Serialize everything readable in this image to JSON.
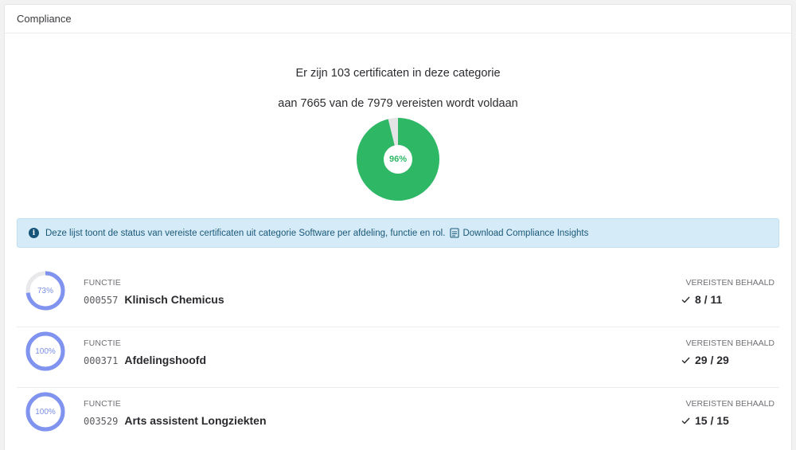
{
  "header": {
    "title": "Compliance"
  },
  "summary": {
    "certificates_line": "Er zijn 103 certificaten in deze categorie",
    "requirements_line": "aan 7665 van de 7979 vereisten wordt voldaan",
    "percent_label": "96%",
    "percent_value": 0.96,
    "colors": {
      "fill": "#2eb866",
      "track": "#e4e4e6"
    }
  },
  "info": {
    "text": "Deze lijst toont de status van vereiste certificaten uit categorie Software per afdeling, functie en rol.",
    "download_label": "Download Compliance Insights",
    "icons": {
      "info": "info-icon",
      "download": "csv-download-icon"
    }
  },
  "rows": [
    {
      "type": "FUNCTIE",
      "code": "000557",
      "name": "Klinisch Chemicus",
      "percent_label": "73%",
      "percent_value": 0.73,
      "req_label": "VEREISTEN BEHAALD",
      "req_count": "8 / 11"
    },
    {
      "type": "FUNCTIE",
      "code": "000371",
      "name": "Afdelingshoofd",
      "percent_label": "100%",
      "percent_value": 1.0,
      "req_label": "VEREISTEN BEHAALD",
      "req_count": "29 / 29"
    },
    {
      "type": "FUNCTIE",
      "code": "003529",
      "name": "Arts assistent Longziekten",
      "percent_label": "100%",
      "percent_value": 1.0,
      "req_label": "VEREISTEN BEHAALD",
      "req_count": "15 / 15"
    }
  ],
  "ring_colors": {
    "fill": "#7f93ef",
    "track": "#e9e9ec"
  }
}
